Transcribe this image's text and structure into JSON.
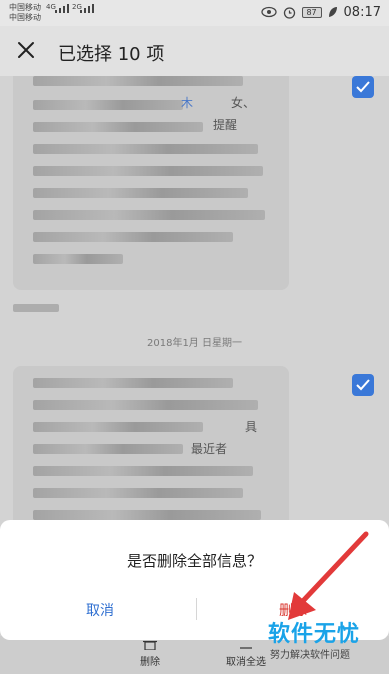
{
  "status_bar": {
    "carrier1": "中国移动",
    "carrier2": "中国移动",
    "net1": "4G",
    "net2": "2G",
    "battery": "87",
    "time": "08:17"
  },
  "header": {
    "title": "已选择 10 项"
  },
  "messages": {
    "link_fragment": "木",
    "link_fragment2": "女、",
    "fragment_remind": "提醒",
    "fragment_ju": "具",
    "fragment_zuiyou": "最近者"
  },
  "date_separator": "2018年1月 日星期一",
  "bottom_bar": {
    "delete_label": "删除",
    "cancel_select_all_label": "取消全选"
  },
  "dialog": {
    "message": "是否删除全部信息？",
    "cancel_label": "取消",
    "delete_label": "删除"
  },
  "watermark": {
    "main": "软件无忧",
    "sub": "努力解决软件问题"
  },
  "colors": {
    "accent_blue": "#2f6fd1",
    "checkbox_blue": "#3a78d8",
    "delete_red": "#d8322a",
    "watermark_blue": "#1aa3e8"
  }
}
